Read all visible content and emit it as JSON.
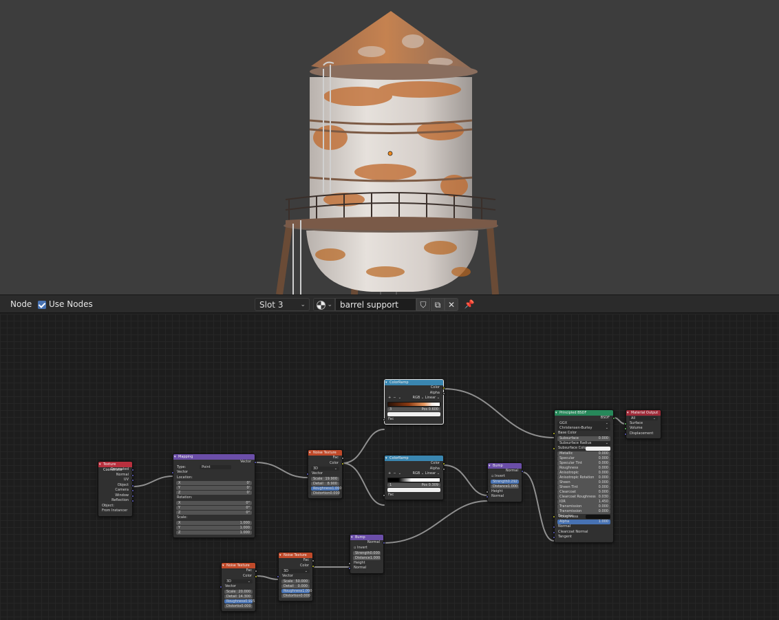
{
  "header": {
    "menu_node": "Node",
    "use_nodes_label": "Use Nodes",
    "slot": "Slot 3",
    "material_name": "barrel support",
    "fake_user_icon": "shield-icon",
    "duplicate_icon": "copy-icon",
    "unlink_icon": "close-icon",
    "pin_icon": "pin-icon"
  },
  "colors": {
    "rust": "#b8651f",
    "tank_white": "#d8d2cd",
    "viewport_bg": "#3d3d3d",
    "editor_bg": "#1d1d1d",
    "accent": "#4772b3"
  },
  "nodes": {
    "texcoord": {
      "title": "Texture Coordinate",
      "outputs": [
        "Generated",
        "Normal",
        "UV",
        "Object",
        "Camera",
        "Window",
        "Reflection"
      ],
      "object_label": "Object:",
      "from_instancer": "From Instancer"
    },
    "mapping": {
      "title": "Mapping",
      "out_vector": "Vector",
      "type_label": "Type:",
      "type_value": "Point",
      "in_vector": "Vector",
      "location_label": "Location:",
      "loc_x": "X",
      "loc_x_val": "0'",
      "loc_y": "Y",
      "loc_y_val": "0'",
      "loc_z": "Z",
      "loc_z_val": "0'",
      "rotation_label": "Rotation:",
      "rot_x": "X",
      "rot_x_val": "0°",
      "rot_y": "Y",
      "rot_y_val": "0°",
      "rot_z": "Z",
      "rot_z_val": "0°",
      "scale_label": "Scale:",
      "sc_x": "X",
      "sc_x_val": "1.000",
      "sc_y": "Y",
      "sc_y_val": "1.000",
      "sc_z": "Z",
      "sc_z_val": "1.000"
    },
    "noise1": {
      "title": "Noise Texture",
      "out_fac": "Fac",
      "out_color": "Color",
      "dim": "3D",
      "in_vector": "Vector",
      "scale_label": "Scale",
      "scale_val": "19.900",
      "detail_label": "Detail",
      "detail_val": "8.900",
      "rough_label": "Roughness",
      "rough_val": "1.000",
      "dist_label": "Distortion",
      "dist_val": "0.000"
    },
    "ramp1": {
      "title": "ColorRamp",
      "out_color": "Color",
      "out_alpha": "Alpha",
      "mode": "RGB",
      "interp": "Linear",
      "index": "3",
      "pos_label": "Pos",
      "pos_val": "0.600",
      "in_fac": "Fac"
    },
    "ramp2": {
      "title": "ColorRamp",
      "out_color": "Color",
      "out_alpha": "Alpha",
      "mode": "RGB",
      "interp": "Linear",
      "index": "1",
      "pos_label": "Pos",
      "pos_val": "0.309",
      "in_fac": "Fac"
    },
    "bump1": {
      "title": "Bump",
      "out_normal": "Normal",
      "invert": "Invert",
      "strength_label": "Strength",
      "strength_val": "0.292",
      "distance_label": "Distance",
      "distance_val": "1.000",
      "in_height": "Height",
      "in_normal": "Normal"
    },
    "bump2": {
      "title": "Bump",
      "out_normal": "Normal",
      "invert": "Invert",
      "strength_label": "Strength",
      "strength_val": "0.000",
      "distance_label": "Distance",
      "distance_val": "1.000",
      "in_height": "Height",
      "in_normal": "Normal"
    },
    "noise2": {
      "title": "Noise Texture",
      "out_fac": "Fac",
      "out_color": "Color",
      "dim": "3D",
      "in_vector": "Vector",
      "scale_label": "Scale",
      "scale_val": "50.000",
      "detail_label": "Detail",
      "detail_val": "0.000",
      "rough_label": "Roughness",
      "rough_val": "1.000",
      "dist_label": "Distortion",
      "dist_val": "0.000"
    },
    "noise3": {
      "title": "Noise Texture",
      "out_fac": "Fac",
      "out_color": "Color",
      "dim": "3D",
      "in_vector": "Vector",
      "scale_label": "Scale",
      "scale_val": "20.000",
      "detail_label": "Detail",
      "detail_val": "14.300",
      "rough_label": "Roughness",
      "rough_val": "0.925",
      "dist_label": "Distortio",
      "dist_val": "0.000"
    },
    "bsdf": {
      "title": "Principled BSDF",
      "out_bsdf": "BSDF",
      "distribution": "GGX",
      "subsurface_method": "Christensen-Burley",
      "base_color": "Base Color",
      "subsurface": "Subsurface",
      "subsurface_val": "0.000",
      "subsurface_radius": "Subsurface Radius",
      "subsurface_color": "Subsurface Colo",
      "metallic": "Metallic",
      "metallic_val": "0.000",
      "specular": "Specular",
      "specular_val": "0.000",
      "specular_tint": "Specular Tint",
      "specular_tint_val": "0.000",
      "roughness": "Roughness",
      "roughness_val": "0.000",
      "anisotropic": "Anisotropic",
      "anisotropic_val": "0.000",
      "aniso_rot": "Anisotropic Rotation",
      "aniso_rot_val": "0.000",
      "sheen": "Sheen",
      "sheen_val": "0.000",
      "sheen_tint": "Sheen Tint",
      "sheen_tint_val": "0.000",
      "clearcoat": "Clearcoat",
      "clearcoat_val": "0.000",
      "clearcoat_rough": "Clearcoat Roughness",
      "clearcoat_rough_val": "0.030",
      "ior": "IOR",
      "ior_val": "1.450",
      "transmission": "Transmission",
      "transmission_val": "0.000",
      "trans_rough": "Transmission Roughness",
      "trans_rough_val": "0.000",
      "emission": "Emission",
      "alpha": "Alpha",
      "alpha_val": "1.000",
      "normal": "Normal",
      "clearcoat_normal": "Clearcoat Normal",
      "tangent": "Tangent"
    },
    "output": {
      "title": "Material Output",
      "target": "All",
      "surface": "Surface",
      "volume": "Volume",
      "displacement": "Displacement"
    }
  }
}
